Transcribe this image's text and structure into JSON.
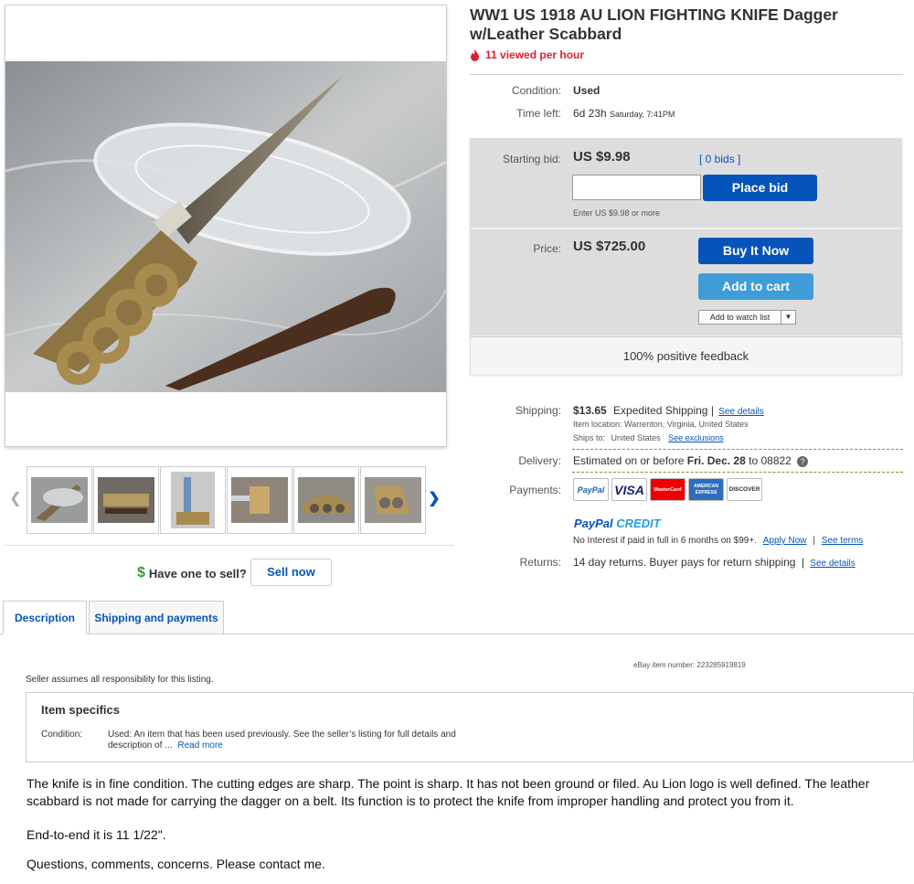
{
  "title": "WW1 US 1918 AU LION FIGHTING KNIFE Dagger w/Leather Scabbard",
  "viewed_text": "11 viewed per hour",
  "condition": {
    "label": "Condition:",
    "value": "Used"
  },
  "time_left": {
    "label": "Time left:",
    "value": "6d 23h",
    "detail": "Saturday, 7:41PM"
  },
  "bid": {
    "label": "Starting bid:",
    "value": "US $9.98",
    "bids_link": "[ 0 bids ]",
    "place_bid_label": "Place bid",
    "hint": "Enter US $9.98 or more"
  },
  "price": {
    "label": "Price:",
    "value": "US $725.00",
    "buy_now_label": "Buy It Now",
    "add_to_cart_label": "Add to cart",
    "watch_label": "Add to watch list"
  },
  "feedback": "100% positive feedback",
  "shipping": {
    "label": "Shipping:",
    "cost": "$13.65",
    "method": "Expedited Shipping",
    "separator": "|",
    "details_link": "See details",
    "location": "Item location:  Warrenton, Virginia, United States",
    "ships_to_label": "Ships to:",
    "ships_to_value": "United States",
    "exclusions_link": "See exclusions"
  },
  "delivery": {
    "label": "Delivery:",
    "prefix": "Estimated on or before",
    "date": "Fri. Dec. 28",
    "suffix": "to 08822",
    "help": "?"
  },
  "payments": {
    "label": "Payments:",
    "logos": [
      "PayPal",
      "VISA",
      "MasterCard",
      "AMERICAN EXPRESS",
      "DISCOVER"
    ],
    "credit_brand_a": "PayPal",
    "credit_brand_b": "CREDIT",
    "credit_text": "No Interest if paid in full in 6 months on $99+.",
    "apply_link": "Apply Now",
    "divider": "|",
    "terms_link": "See terms"
  },
  "returns": {
    "label": "Returns:",
    "value": "14 day returns. Buyer pays for return shipping",
    "divider": "|",
    "details_link": "See details"
  },
  "sell": {
    "dollar": "$",
    "text": "Have one to sell?",
    "button": "Sell now"
  },
  "tabs": [
    "Description",
    "Shipping and payments"
  ],
  "item_number": "eBay item number:    223285919819",
  "responsibility": "Seller assumes all responsibility for this listing.",
  "specifics": {
    "title": "Item specifics",
    "condition_label": "Condition:",
    "condition_value": "Used: An item that has been used previously. See the seller’s listing for full details and description of ...",
    "read_more": "Read more"
  },
  "description": [
    "The knife is in fine condition. The cutting edges are sharp. The point is sharp. It has not been ground or filed. Au Lion logo is well defined. The leather scabbard is not made for carrying the dagger on a belt. Its function is to protect the knife from improper handling and protect you from it.",
    "End-to-end it is 11 1/22\".",
    "Questions, comments, concerns. Please contact me."
  ],
  "colors": {
    "link": "#0654ba",
    "viewed": "#dd1e31",
    "button": "#0654ba",
    "cart": "#3f9cd7"
  },
  "icons": {
    "viewed": "flame-icon",
    "prev": "chevron-left-icon",
    "next": "chevron-right-icon"
  }
}
